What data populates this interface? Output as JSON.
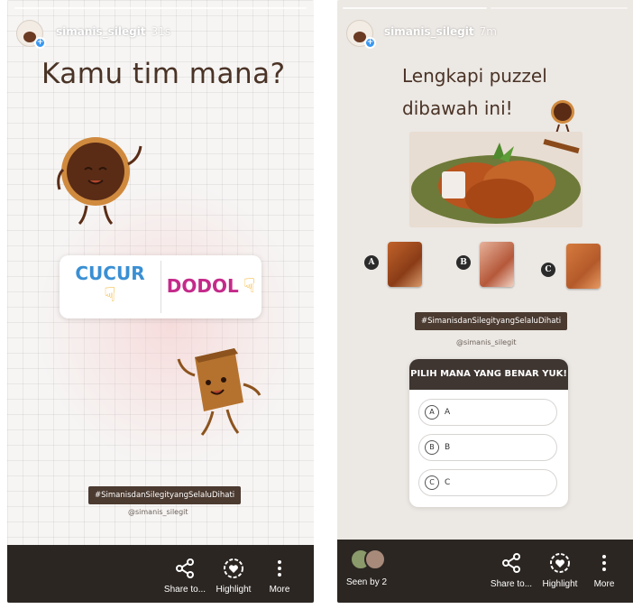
{
  "story1": {
    "username": "simanis_silegit",
    "time": "31s",
    "title": "Kamu tim mana?",
    "poll": {
      "option_a": "CUCUR",
      "option_b": "DODOL",
      "option_a_color": "#3a8fd3",
      "option_b_color": "#c42a8a"
    },
    "hashtag": "#SimanisdanSilegityangSelaluDihati",
    "mention": "@simanis_silegit",
    "bottom": {
      "share": "Share to...",
      "highlight": "Highlight",
      "more": "More"
    }
  },
  "story2": {
    "username": "simanis_silegit",
    "time": "7m",
    "title_line1": "Lengkapi puzzel",
    "title_line2": "dibawah ini!",
    "pieces": [
      "A",
      "B",
      "C"
    ],
    "hashtag": "#SimanisdanSilegityangSelaluDihati",
    "mention": "@simanis_silegit",
    "quiz": {
      "question": "PILIH MANA YANG BENAR YUK!",
      "options": [
        {
          "letter": "A",
          "text": "A"
        },
        {
          "letter": "B",
          "text": "B"
        },
        {
          "letter": "C",
          "text": "C"
        }
      ]
    },
    "bottom": {
      "seen": "Seen by 2",
      "share": "Share to...",
      "highlight": "Highlight",
      "more": "More"
    }
  }
}
